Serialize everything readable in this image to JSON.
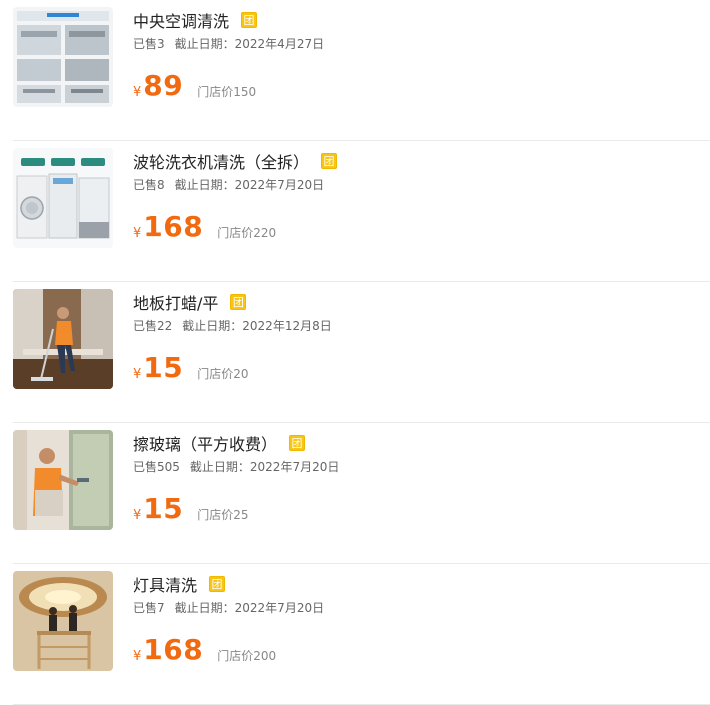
{
  "deals": [
    {
      "title": "中央空调清洗",
      "badge": "团",
      "sold": "已售3",
      "deadline": "截止日期：2022年4月27日",
      "currency": "¥",
      "price": "89",
      "store_price": "门店价150",
      "image": "central-ac-cleaning-photo"
    },
    {
      "title": "波轮洗衣机清洗（全拆）",
      "badge": "团",
      "sold": "已售8",
      "deadline": "截止日期：2022年7月20日",
      "currency": "¥",
      "price": "168",
      "store_price": "门店价220",
      "image": "washing-machines-photo"
    },
    {
      "title": "地板打蜡/平",
      "badge": "团",
      "sold": "已售22",
      "deadline": "截止日期：2022年12月8日",
      "currency": "¥",
      "price": "15",
      "store_price": "门店价20",
      "image": "floor-mopping-photo"
    },
    {
      "title": "擦玻璃（平方收费）",
      "badge": "团",
      "sold": "已售505",
      "deadline": "截止日期：2022年7月20日",
      "currency": "¥",
      "price": "15",
      "store_price": "门店价25",
      "image": "window-cleaning-photo"
    },
    {
      "title": "灯具清洗",
      "badge": "团",
      "sold": "已售7",
      "deadline": "截止日期：2022年7月20日",
      "currency": "¥",
      "price": "168",
      "store_price": "门店价200",
      "image": "chandelier-cleaning-photo"
    }
  ],
  "colors": {
    "price": "#f26a10",
    "badge": "#f6c515",
    "divider": "#e9e9e9"
  }
}
